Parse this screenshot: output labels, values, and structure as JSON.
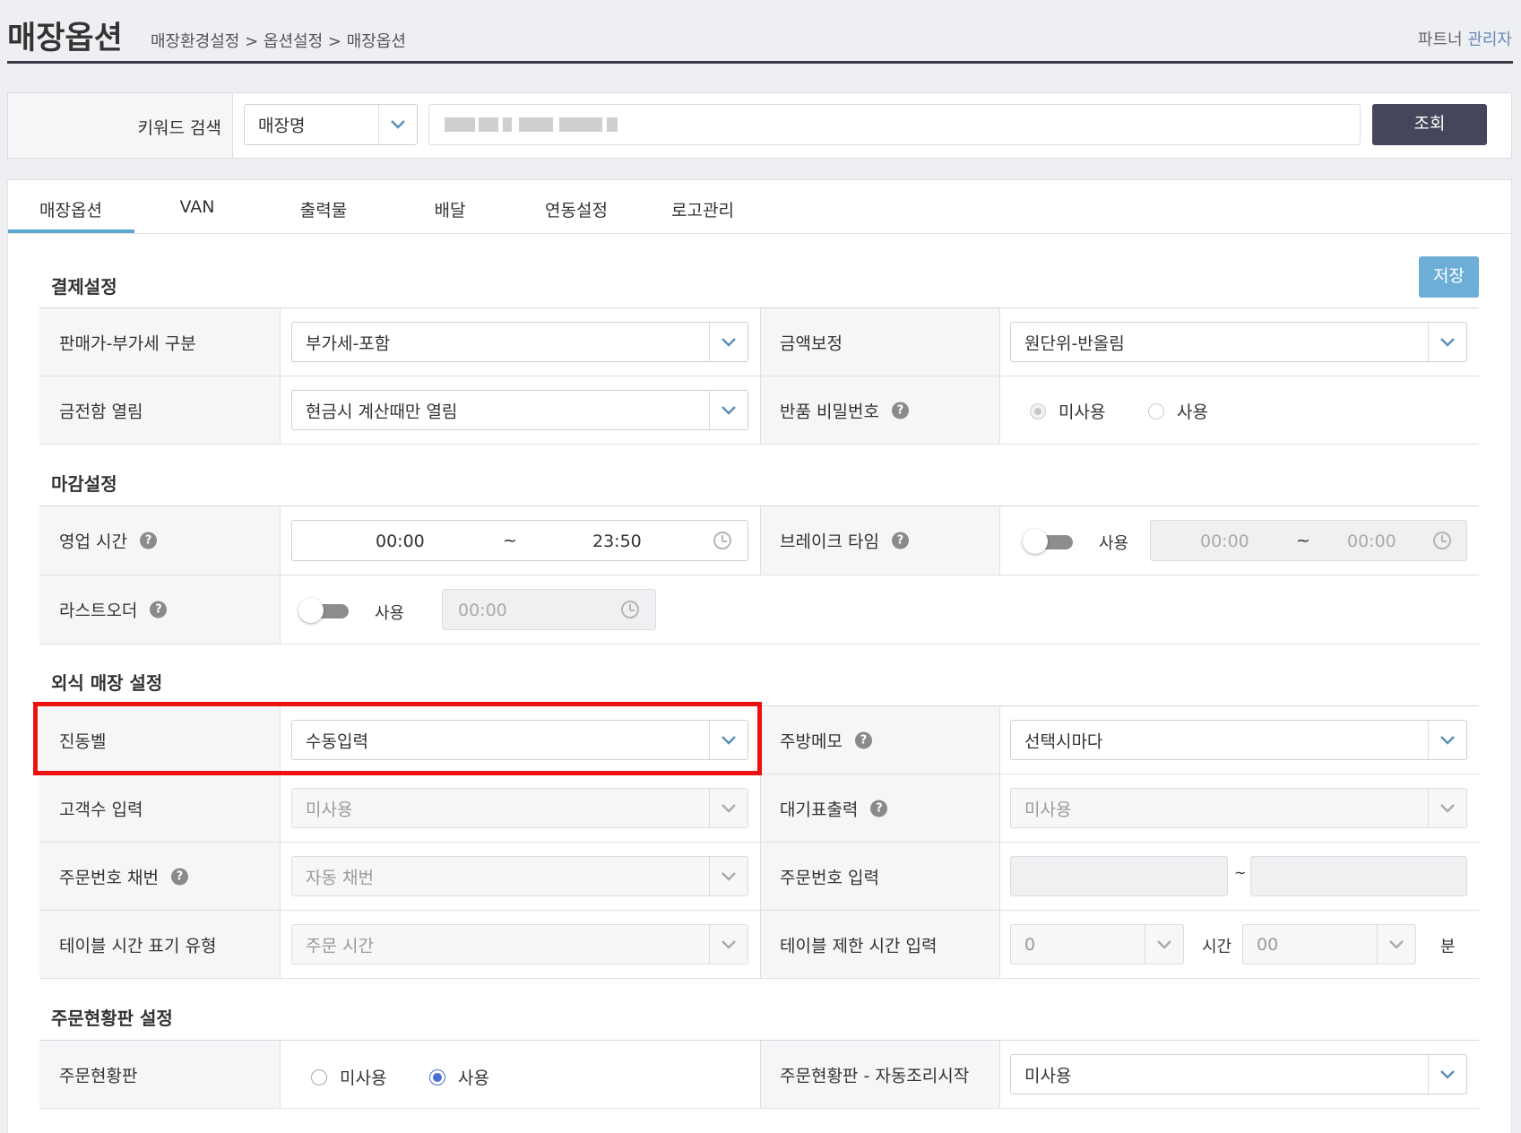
{
  "header": {
    "title": "매장옵션",
    "breadcrumb": "매장환경설정 > 옵션설정 > 매장옵션",
    "partner_label": "파트너",
    "admin_label": "관리자"
  },
  "search": {
    "label": "키워드 검색",
    "type_value": "매장명",
    "submit_label": "조회"
  },
  "tabs": [
    "매장옵션",
    "VAN",
    "출력물",
    "배달",
    "연동설정",
    "로고관리"
  ],
  "save_label": "저장",
  "payment": {
    "title": "결제설정",
    "vat_label": "판매가-부가세 구분",
    "vat_value": "부가세-포함",
    "amount_label": "금액보정",
    "amount_value": "원단위-반올림",
    "drawer_label": "금전함 열림",
    "drawer_value": "현금시 계산때만 열림",
    "refund_pw_label": "반품 비밀번호",
    "refund_pw_options": [
      "미사용",
      "사용"
    ]
  },
  "closing": {
    "title": "마감설정",
    "hours_label": "영업 시간",
    "hours_start": "00:00",
    "hours_sep": "~",
    "hours_end": "23:50",
    "break_label": "브레이크 타임",
    "break_use": "사용",
    "break_start": "00:00",
    "break_sep": "~",
    "break_end": "00:00",
    "last_order_label": "라스트오더",
    "last_order_use": "사용",
    "last_order_time": "00:00"
  },
  "dine": {
    "title": "외식 매장 설정",
    "bell_label": "진동벨",
    "bell_value": "수동입력",
    "kitchen_memo_label": "주방메모",
    "kitchen_memo_value": "선택시마다",
    "guest_label": "고객수 입력",
    "guest_value": "미사용",
    "queue_label": "대기표출력",
    "queue_value": "미사용",
    "order_no_label": "주문번호 채번",
    "order_no_value": "자동 채번",
    "order_no_input_label": "주문번호 입력",
    "order_no_sep": "~",
    "table_time_type_label": "테이블 시간 표기 유형",
    "table_time_type_value": "주문 시간",
    "table_limit_label": "테이블 제한 시간 입력",
    "table_limit_hours": "0",
    "hours_unit": "시간",
    "table_limit_minutes": "00",
    "minutes_unit": "분"
  },
  "board": {
    "title": "주문현황판 설정",
    "board_label": "주문현황판",
    "board_options": [
      "미사용",
      "사용"
    ],
    "auto_cook_label": "주문현황판 - 자동조리시작",
    "auto_cook_value": "미사용"
  }
}
